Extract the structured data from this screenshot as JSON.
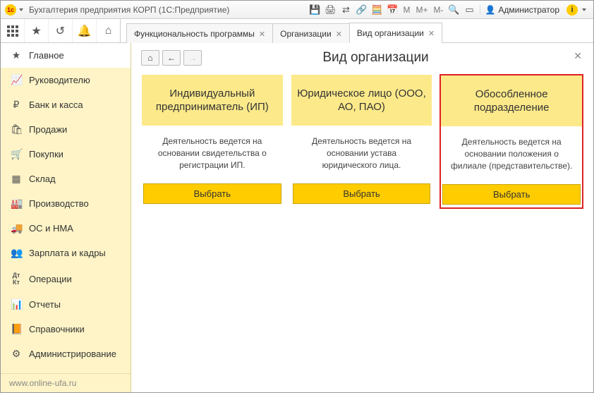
{
  "titlebar": {
    "title": "Бухгалтерия предприятия КОРП  (1С:Предприятие)",
    "m": "M",
    "mplus": "M+",
    "mminus": "M-",
    "user": "Администратор"
  },
  "tabs": [
    {
      "label": "Функциональность программы",
      "active": false
    },
    {
      "label": "Организации",
      "active": false
    },
    {
      "label": "Вид организации",
      "active": true
    }
  ],
  "sidebar": {
    "items": [
      {
        "icon": "★",
        "label": "Главное"
      },
      {
        "icon": "chart",
        "label": "Руководителю"
      },
      {
        "icon": "ruble",
        "label": "Банк и касса"
      },
      {
        "icon": "bag",
        "label": "Продажи"
      },
      {
        "icon": "cart",
        "label": "Покупки"
      },
      {
        "icon": "boxes",
        "label": "Склад"
      },
      {
        "icon": "factory",
        "label": "Производство"
      },
      {
        "icon": "truck",
        "label": "ОС и НМА"
      },
      {
        "icon": "people",
        "label": "Зарплата и кадры"
      },
      {
        "icon": "dtkt",
        "label": "Операции"
      },
      {
        "icon": "bars",
        "label": "Отчеты"
      },
      {
        "icon": "book",
        "label": "Справочники"
      },
      {
        "icon": "gear",
        "label": "Администрирование"
      }
    ],
    "footer": "www.online-ufa.ru"
  },
  "page": {
    "title": "Вид организации",
    "select_label": "Выбрать"
  },
  "cards": [
    {
      "title": "Индивидуальный предприниматель (ИП)",
      "desc": "Деятельность ведется на основании свидетельства о регистрации ИП.",
      "highlight": false
    },
    {
      "title": "Юридическое лицо (ООО, АО, ПАО)",
      "desc": "Деятельность ведется на основании устава юридического лица.",
      "highlight": false
    },
    {
      "title": "Обособленное подразделение",
      "desc": "Деятельность ведется на основании положения о филиале (представительстве).",
      "highlight": true
    }
  ]
}
